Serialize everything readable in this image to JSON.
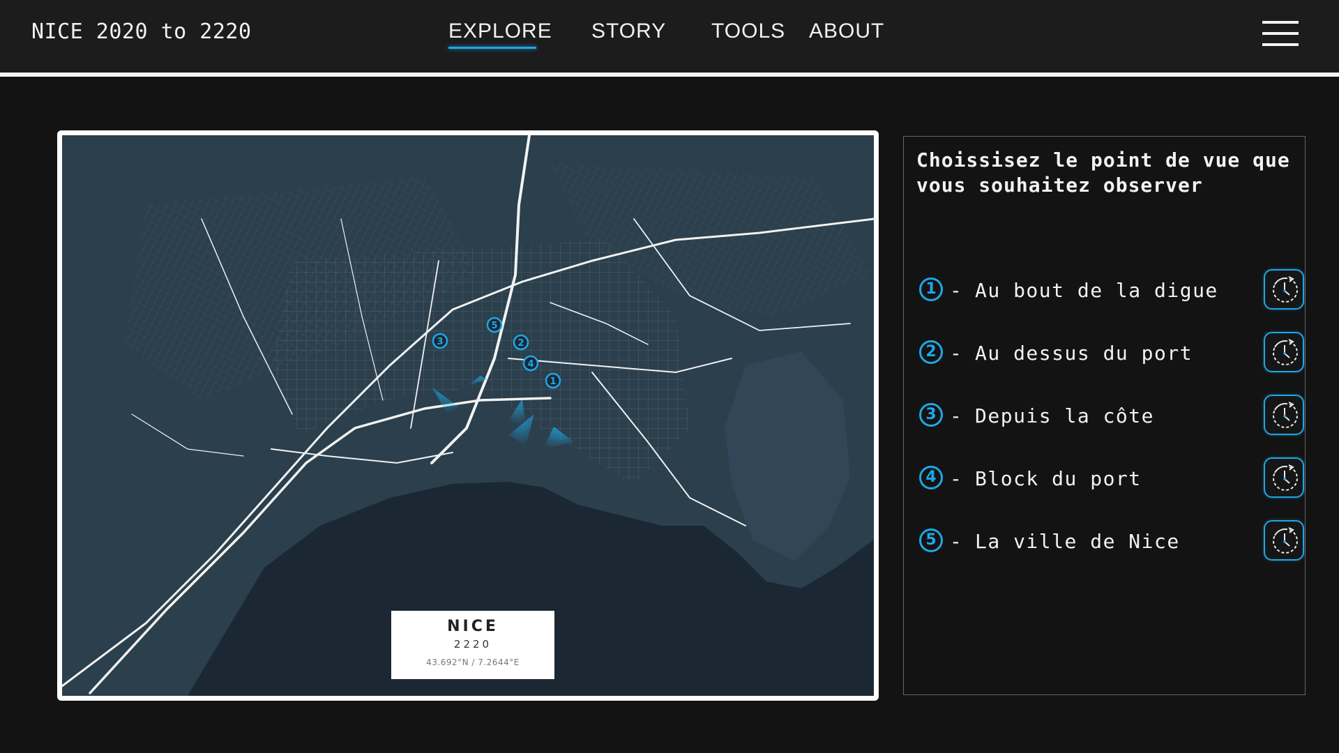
{
  "header": {
    "site_title": "NICE 2020 to 2220",
    "nav": [
      {
        "label": "EXPLORE",
        "active": true
      },
      {
        "label": "STORY"
      },
      {
        "label": "TOOLS"
      },
      {
        "label": "ABOUT"
      }
    ],
    "menu_icon": "hamburger-menu-icon"
  },
  "map": {
    "markers": [
      "1",
      "2",
      "3",
      "4",
      "5"
    ],
    "legend": {
      "city": "NICE",
      "year": "2220",
      "coords": "43.692°N / 7.2644°E"
    }
  },
  "panel": {
    "title": "Choissisez le point de vue que vous souhaitez observer",
    "viewpoints": [
      {
        "num": "1",
        "label": "Au bout de la digue",
        "icon": "clock-rewind-icon"
      },
      {
        "num": "2",
        "label": "Au dessus du port",
        "icon": "clock-rewind-icon"
      },
      {
        "num": "3",
        "label": "Depuis la côte",
        "icon": "clock-rewind-icon"
      },
      {
        "num": "4",
        "label": "Block du port",
        "icon": "clock-rewind-icon"
      },
      {
        "num": "5",
        "label": "La ville de Nice",
        "icon": "clock-rewind-icon"
      }
    ],
    "dash": "-"
  },
  "colors": {
    "accent": "#1ea7e8",
    "background": "#131313",
    "header": "#1c1c1c",
    "map_land": "#2b3f4c",
    "map_sea": "#1b2833"
  }
}
